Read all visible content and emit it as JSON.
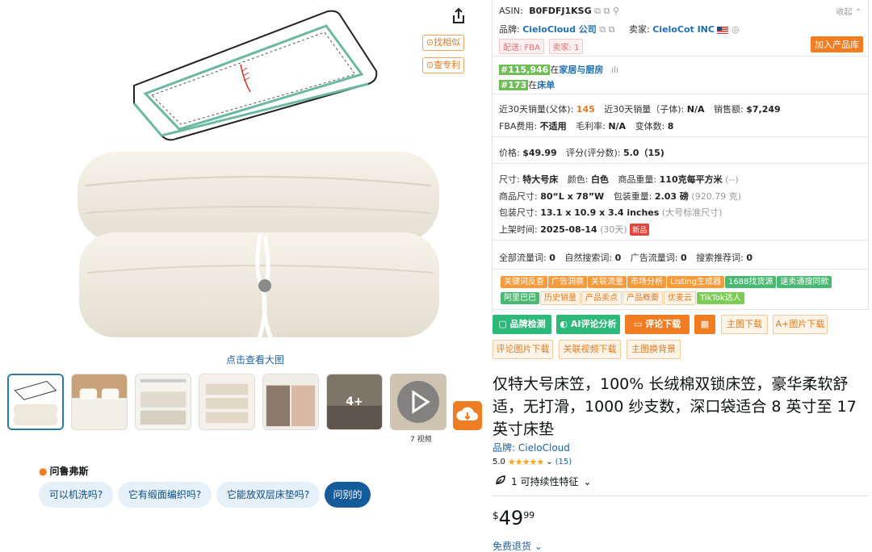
{
  "gallery": {
    "find_similar": "找相似",
    "check_patent": "查专利",
    "view_large": "点击查看大图",
    "more_label": "4+",
    "video_count": "7 视频"
  },
  "rufus": {
    "title": "问鲁弗斯",
    "chips": [
      "可以机洗吗?",
      "它有缎面编织吗?",
      "它能放双层床垫吗?",
      "问别的"
    ]
  },
  "panel": {
    "asin_label": "ASIN:",
    "asin": "B0FDFJ1KSG",
    "collapse": "收起",
    "brand_label": "品牌:",
    "brand": "CieloCloud 公司",
    "seller_label": "卖家:",
    "seller": "CieloCot INC",
    "delivery_tag": "配送: FBA",
    "sellers_tag": "卖家: 1",
    "add_library": "加入产品库",
    "rank1_num": "#115,946",
    "rank1_pre": "在",
    "rank1_cat": "家居与厨房",
    "rank2_num": "#173",
    "rank2_pre": "在",
    "rank2_cat": "床单",
    "sales30_parent_label": "近30天销量(父体):",
    "sales30_parent": "145",
    "sales30_child_label": "近30天销量（子体):",
    "sales30_child": "N/A",
    "revenue_label": "销售额:",
    "revenue": "$7,249",
    "fba_fee_label": "FBA费用:",
    "fba_fee": "不适用",
    "margin_label": "毛利率:",
    "margin": "N/A",
    "variants_label": "变体数:",
    "variants": "8",
    "price_label": "价格:",
    "price": "$49.99",
    "rating_label": "评分(评分数):",
    "rating": "5.0（15)",
    "size_label": "尺寸:",
    "size": "特大号床",
    "color_label": "颜色:",
    "color": "白色",
    "weight_label": "商品重量:",
    "weight": "110克每平方米",
    "weight_extra": "(--)",
    "dims_label": "商品尺寸:",
    "dims": "80“L x 78”W",
    "pkg_weight_label": "包装重量:",
    "pkg_weight": "2.03 磅",
    "pkg_weight_extra": "(920.79 克)",
    "pkg_dims_label": "包装尺寸:",
    "pkg_dims": "13.1 x 10.9 x 3.4 inches",
    "pkg_dims_extra": "(大号标准尺寸)",
    "listed_label": "上架时间:",
    "listed": "2025-08-14",
    "listed_extra": "(30天)",
    "new_badge": "新品",
    "kw_all_label": "全部流量词:",
    "kw_all": "0",
    "kw_organic_label": "自然搜索词:",
    "kw_organic": "0",
    "kw_ad_label": "广告流量词:",
    "kw_ad": "0",
    "kw_rec_label": "搜索推荐词:",
    "kw_rec": "0",
    "tools_row1": [
      "关键词反查",
      "广告洞察",
      "关联流量",
      "市场分析",
      "Listing生成器",
      "1688找货源",
      "速卖通搜同款"
    ],
    "tools_row2": [
      "阿里巴巴",
      "历史销量",
      "产品卖点",
      "产品概要",
      "优麦云",
      "TikTok达人"
    ]
  },
  "buttons": {
    "brand_check": "品牌检测",
    "ai_review": "AI评论分析",
    "review_download": "评论下载",
    "main_img_download": "主图下载",
    "aplus_download": "A+图片下载",
    "review_img_download": "评论图片下载",
    "video_download": "关联视频下载",
    "replace_bg": "主图换背景"
  },
  "product": {
    "title": "仅特大号床笠，100% 长绒棉双锁床笠，豪华柔软舒适，无打滑，1000 纱支数，深口袋适合 8 英寸至 17 英寸床垫",
    "brand_line": "品牌:  CieloCloud",
    "rating_value": "5.0",
    "stars": "★★★★★",
    "rating_count": "(15)",
    "sustainability": "1 可持续性特征",
    "price_symbol": "$",
    "price_whole": "49",
    "price_fraction": "99",
    "free_returns": "免费退货"
  },
  "colors": {
    "accent_orange": "#f07d22",
    "accent_green": "#2db97a",
    "link_blue": "#2162a1",
    "rank_green": "#6fbe55"
  }
}
